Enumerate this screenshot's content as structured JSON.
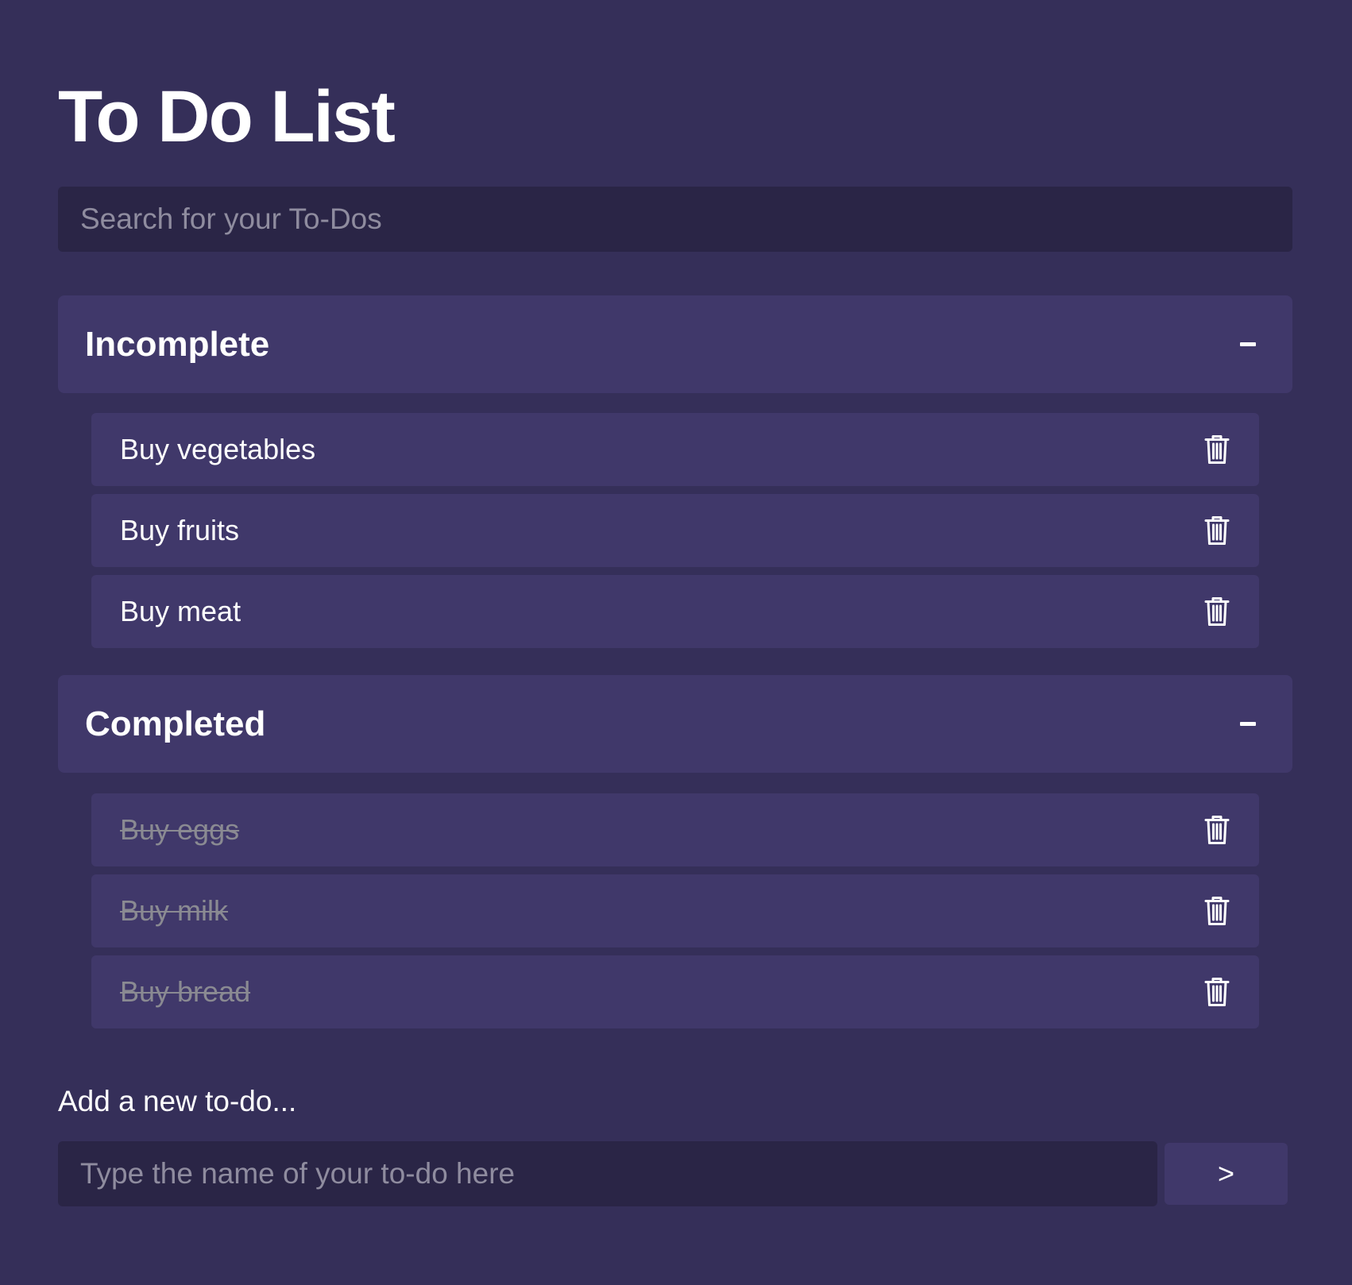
{
  "title": "To Do List",
  "search": {
    "placeholder": "Search for your To-Dos",
    "value": ""
  },
  "sections": {
    "incomplete": {
      "label": "Incomplete",
      "collapse_icon": "minus-icon",
      "items": [
        {
          "label": "Buy vegetables",
          "completed": false
        },
        {
          "label": "Buy fruits",
          "completed": false
        },
        {
          "label": "Buy meat",
          "completed": false
        }
      ]
    },
    "completed": {
      "label": "Completed",
      "collapse_icon": "minus-icon",
      "items": [
        {
          "label": "Buy eggs",
          "completed": true
        },
        {
          "label": "Buy milk",
          "completed": true
        },
        {
          "label": "Buy bread",
          "completed": true
        }
      ]
    }
  },
  "add_todo": {
    "label": "Add a new to-do...",
    "placeholder": "Type the name of your to-do here",
    "value": "",
    "submit_label": ">"
  },
  "colors": {
    "background": "#352f59",
    "panel": "#40386a",
    "input": "#2a2546",
    "text": "#ffffff",
    "muted_text": "#8a8a92"
  },
  "icons": {
    "delete": "trash-icon",
    "collapse": "minus-icon"
  }
}
